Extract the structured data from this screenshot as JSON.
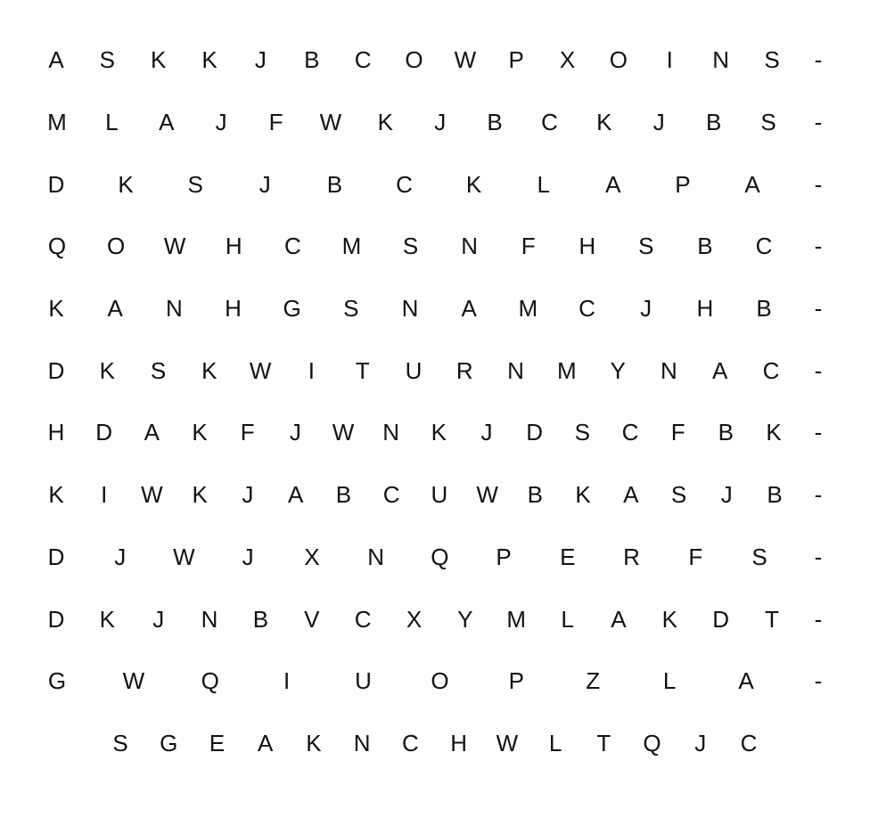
{
  "rows": [
    {
      "letters": [
        "A",
        "S",
        "K",
        "K",
        "J",
        "B",
        "C",
        "O",
        "W",
        "P",
        "X",
        "O",
        "I",
        "N",
        "S"
      ],
      "end": "-"
    },
    {
      "letters": [
        "M",
        "L",
        "A",
        "J",
        "F",
        "W",
        "K",
        "J",
        "B",
        "C",
        "K",
        "J",
        "B",
        "S"
      ],
      "end": "-"
    },
    {
      "letters": [
        "D",
        "K",
        "S",
        "J",
        "B",
        "C",
        "K",
        "L",
        "A",
        "P",
        "A"
      ],
      "end": "-"
    },
    {
      "letters": [
        "Q",
        "O",
        "W",
        "H",
        "C",
        "M",
        "S",
        "N",
        "F",
        "H",
        "S",
        "B",
        "C"
      ],
      "end": "-"
    },
    {
      "letters": [
        "K",
        "A",
        "N",
        "H",
        "G",
        "S",
        "N",
        "A",
        "M",
        "C",
        "J",
        "H",
        "B"
      ],
      "end": "-"
    },
    {
      "letters": [
        "D",
        "K",
        "S",
        "K",
        "W",
        "I",
        "T",
        "U",
        "R",
        "N",
        "M",
        "Y",
        "N",
        "A",
        "C"
      ],
      "end": "-"
    },
    {
      "letters": [
        "H",
        "D",
        "A",
        "K",
        "F",
        "J",
        "W",
        "N",
        "K",
        "J",
        "D",
        "S",
        "C",
        "F",
        "B",
        "K"
      ],
      "end": "-"
    },
    {
      "letters": [
        "K",
        "I",
        "W",
        "K",
        "J",
        "A",
        "B",
        "C",
        "U",
        "W",
        "B",
        "K",
        "A",
        "S",
        "J",
        "B"
      ],
      "end": "-"
    },
    {
      "letters": [
        "D",
        "J",
        "W",
        "J",
        "X",
        "N",
        "Q",
        "P",
        "E",
        "R",
        "F",
        "S"
      ],
      "end": "-"
    },
    {
      "letters": [
        "D",
        "K",
        "J",
        "N",
        "B",
        "V",
        "C",
        "X",
        "Y",
        "M",
        "L",
        "A",
        "K",
        "D",
        "T"
      ],
      "end": "-"
    },
    {
      "letters": [
        "G",
        "W",
        "Q",
        "I",
        "U",
        "O",
        "P",
        "Z",
        "L",
        "A"
      ],
      "end": "-"
    },
    {
      "letters": [
        "S",
        "G",
        "E",
        "A",
        "K",
        "N",
        "C",
        "H",
        "W",
        "L",
        "T",
        "Q",
        "J",
        "C"
      ],
      "end": ""
    }
  ]
}
